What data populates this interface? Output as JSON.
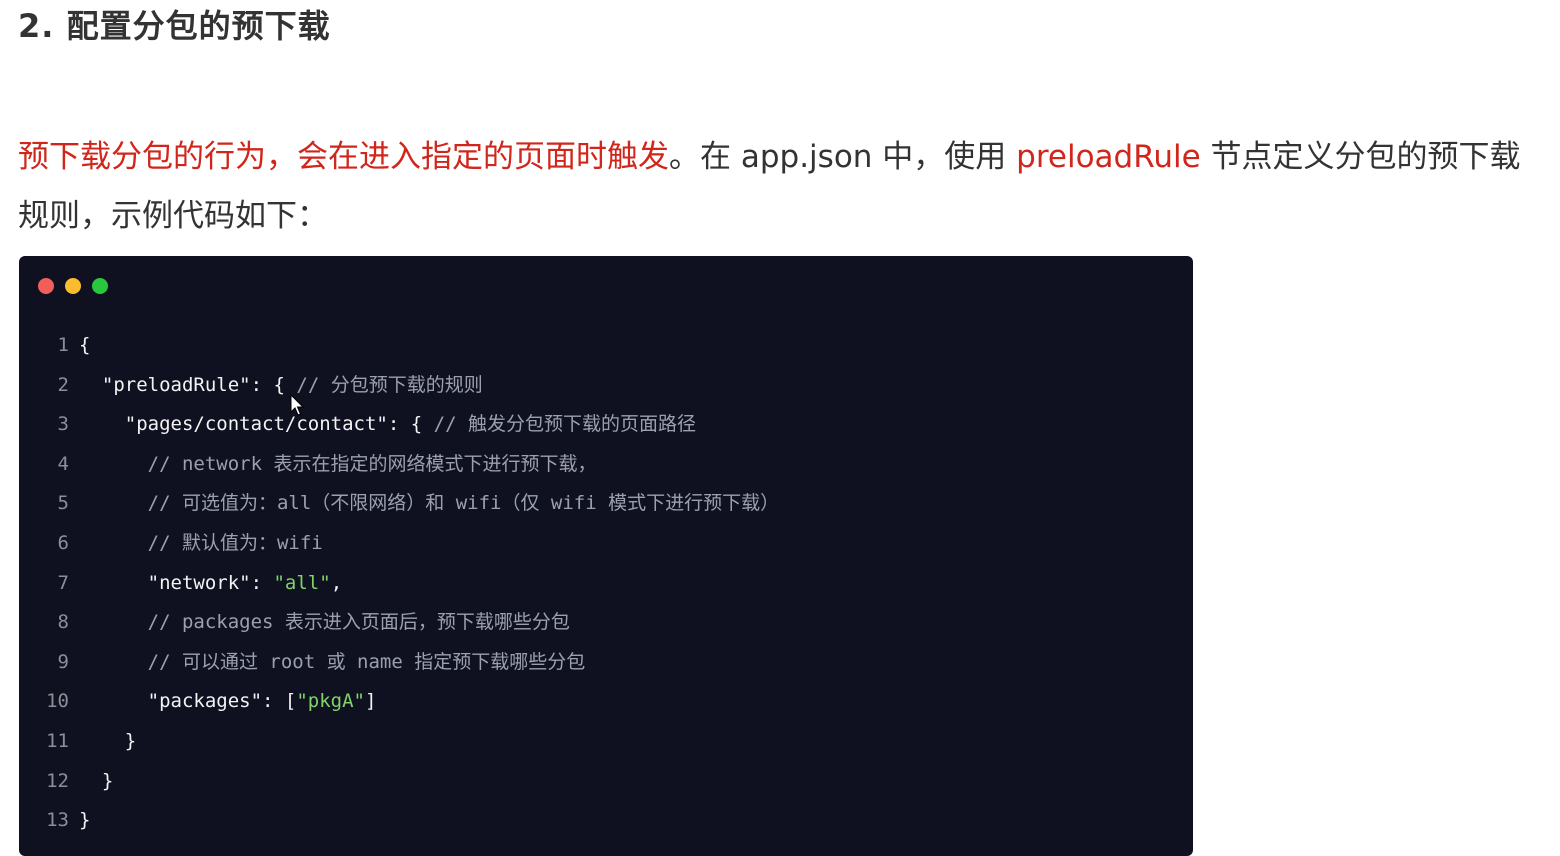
{
  "heading": "2. 配置分包的预下载",
  "paragraph": {
    "highlight_1": "预下载分包的行为，会在进入指定的页面时触发",
    "text_1": "。在 app.json 中，使用 ",
    "highlight_2": "preloadRule",
    "text_2": " 节点定义分包的预下载",
    "text_3": "规则，示例代码如下："
  },
  "code": {
    "lines": [
      {
        "n": "1",
        "indent": "",
        "key": "{",
        "punct": "",
        "value": "",
        "end": "",
        "comment": ""
      },
      {
        "n": "2",
        "indent": "  ",
        "key": "\"preloadRule\"",
        "punct": ": { ",
        "value": "",
        "end": "",
        "comment": "// 分包预下载的规则"
      },
      {
        "n": "3",
        "indent": "    ",
        "key": "\"pages/contact/contact\"",
        "punct": ": { ",
        "value": "",
        "end": "",
        "comment": "// 触发分包预下载的页面路径"
      },
      {
        "n": "4",
        "indent": "      ",
        "key": "",
        "punct": "",
        "value": "",
        "end": "",
        "comment": "// network 表示在指定的网络模式下进行预下载，"
      },
      {
        "n": "5",
        "indent": "      ",
        "key": "",
        "punct": "",
        "value": "",
        "end": "",
        "comment": "// 可选值为：all（不限网络）和 wifi（仅 wifi 模式下进行预下载）"
      },
      {
        "n": "6",
        "indent": "      ",
        "key": "",
        "punct": "",
        "value": "",
        "end": "",
        "comment": "// 默认值为：wifi"
      },
      {
        "n": "7",
        "indent": "      ",
        "key": "\"network\"",
        "punct": ": ",
        "value": "\"all\"",
        "end": ",",
        "comment": ""
      },
      {
        "n": "8",
        "indent": "      ",
        "key": "",
        "punct": "",
        "value": "",
        "end": "",
        "comment": "// packages 表示进入页面后，预下载哪些分包"
      },
      {
        "n": "9",
        "indent": "      ",
        "key": "",
        "punct": "",
        "value": "",
        "end": "",
        "comment": "// 可以通过 root 或 name 指定预下载哪些分包"
      },
      {
        "n": "10",
        "indent": "      ",
        "key": "\"packages\"",
        "punct": ": [",
        "value": "\"pkgA\"",
        "end": "]",
        "comment": ""
      },
      {
        "n": "11",
        "indent": "    ",
        "key": "}",
        "punct": "",
        "value": "",
        "end": "",
        "comment": ""
      },
      {
        "n": "12",
        "indent": "  ",
        "key": "}",
        "punct": "",
        "value": "",
        "end": "",
        "comment": ""
      },
      {
        "n": "13",
        "indent": "",
        "key": "}",
        "punct": "",
        "value": "",
        "end": "",
        "comment": ""
      }
    ]
  },
  "colors": {
    "highlight": "#d1261b",
    "code_background": "#0f1121",
    "string": "#7fd36a",
    "comment": "#9aa0ad",
    "dot_red": "#f25f58",
    "dot_yellow": "#fbbc2e",
    "dot_green": "#29c73e"
  },
  "icons": {
    "window_controls": [
      "close-dot",
      "minimize-dot",
      "maximize-dot"
    ],
    "cursor": "mouse-pointer-icon"
  }
}
